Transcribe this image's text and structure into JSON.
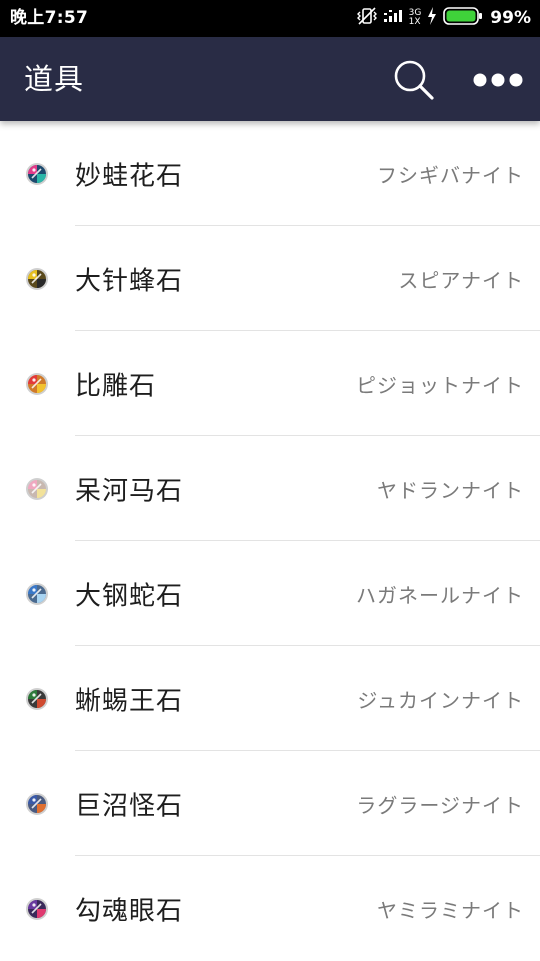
{
  "status_bar": {
    "time": "晚上7:57",
    "network_top": "3G",
    "network_bottom": "1X",
    "battery_percent": "99%",
    "icons": [
      "vibrate-mute-icon",
      "signal-icon",
      "charging-icon",
      "battery-icon"
    ]
  },
  "app_bar": {
    "title": "道具",
    "actions": [
      "search-icon",
      "more-options-icon"
    ]
  },
  "items": [
    {
      "name": "妙蛙花石",
      "japanese": "フシギバナイト",
      "colors": [
        "#e23c8a",
        "#2bb6a8",
        "#1d4a6e"
      ]
    },
    {
      "name": "大针蜂石",
      "japanese": "スピアナイト",
      "colors": [
        "#e8c020",
        "#2a2a2a",
        "#5a4a1c"
      ]
    },
    {
      "name": "比雕石",
      "japanese": "ピジョットナイト",
      "colors": [
        "#e23a3a",
        "#f2c230",
        "#d07a2a"
      ]
    },
    {
      "name": "呆河马石",
      "japanese": "ヤドランナイト",
      "colors": [
        "#f0a8c0",
        "#f2e29a",
        "#c8b8b0"
      ]
    },
    {
      "name": "大钢蛇石",
      "japanese": "ハガネールナイト",
      "colors": [
        "#3a78c8",
        "#a8d4f2",
        "#4a6a90"
      ]
    },
    {
      "name": "蜥蜴王石",
      "japanese": "ジュカインナイト",
      "colors": [
        "#2e7a3a",
        "#d04a30",
        "#3a3a3a"
      ]
    },
    {
      "name": "巨沼怪石",
      "japanese": "ラグラージナイト",
      "colors": [
        "#3a5aa8",
        "#e07030",
        "#4a5a80"
      ]
    },
    {
      "name": "勾魂眼石",
      "japanese": "ヤミラミナイト",
      "colors": [
        "#6a3aa0",
        "#e03a70",
        "#3a2a5a"
      ]
    }
  ]
}
